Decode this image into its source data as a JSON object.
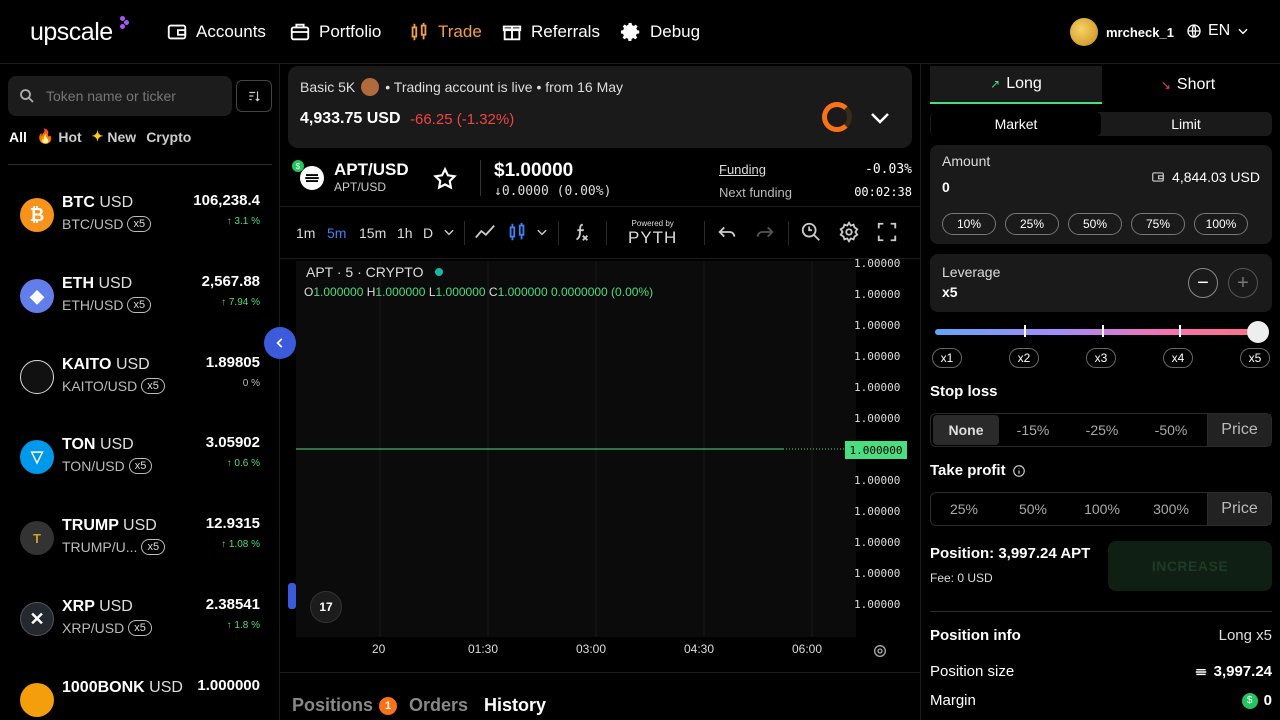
{
  "nav": {
    "logo": "upscale",
    "items": [
      {
        "label": "Accounts",
        "icon": "wallet-icon"
      },
      {
        "label": "Portfolio",
        "icon": "briefcase-icon"
      },
      {
        "label": "Trade",
        "icon": "candles-icon",
        "active": true
      },
      {
        "label": "Referrals",
        "icon": "gift-icon"
      },
      {
        "label": "Debug",
        "icon": "gear-icon"
      }
    ],
    "username": "mrcheck_1",
    "language": "EN"
  },
  "sidebar": {
    "search_placeholder": "Token name or ticker",
    "filters": [
      "All",
      "Hot",
      "New",
      "Crypto"
    ],
    "assets": [
      {
        "base": "BTC",
        "quote": "USD",
        "pair": "BTC/USD",
        "leverage": "x5",
        "price": "106,238.4",
        "change": "↑ 3.1 %",
        "color": "#f7931a",
        "glyph": "₿"
      },
      {
        "base": "ETH",
        "quote": "USD",
        "pair": "ETH/USD",
        "leverage": "x5",
        "price": "2,567.88",
        "change": "↑ 7.94 %",
        "color": "#627eea",
        "glyph": "◆"
      },
      {
        "base": "KAITO",
        "quote": "USD",
        "pair": "KAITO/USD",
        "leverage": "x5",
        "price": "1.89805",
        "change": "0 %",
        "color": "#ffffff",
        "glyph": ""
      },
      {
        "base": "TON",
        "quote": "USD",
        "pair": "TON/USD",
        "leverage": "x5",
        "price": "3.05902",
        "change": "↑ 0.6 %",
        "color": "#0098ea",
        "glyph": "▽"
      },
      {
        "base": "TRUMP",
        "quote": "USD",
        "pair": "TRUMP/U...",
        "leverage": "x5",
        "price": "12.9315",
        "change": "↑ 1.08 %",
        "color": "#c9a227",
        "glyph": "T"
      },
      {
        "base": "XRP",
        "quote": "USD",
        "pair": "XRP/USD",
        "leverage": "x5",
        "price": "2.38541",
        "change": "↑ 1.8 %",
        "color": "#23292f",
        "glyph": "✕"
      },
      {
        "base": "1000BONK",
        "quote": "USD",
        "pair": "",
        "leverage": "",
        "price": "1.000000",
        "change": "",
        "color": "#f59e0b",
        "glyph": ""
      }
    ]
  },
  "account": {
    "name": "Basic 5K",
    "status": "• Trading account is live • from 16 May",
    "balance": "4,933.75 USD",
    "change": "-66.25 (-1.32%)"
  },
  "ticker": {
    "symbol": "APT/USD",
    "pair": "APT/USD",
    "price": "$1.00000",
    "delta": "0.0000 (0.00%)",
    "funding_label": "Funding",
    "funding_rate": "-0.03%",
    "next_funding_label": "Next funding",
    "next_funding_time": "00:02:38"
  },
  "chart": {
    "timeframes": [
      "1m",
      "5m",
      "15m",
      "1h",
      "D"
    ],
    "selected_timeframe": "5m",
    "powered_by": "Powered by",
    "pyth": "PYTH",
    "legend_title": "APT · 5 · CRYPTO",
    "ohlc": {
      "o": "1.000000",
      "h": "1.000000",
      "l": "1.000000",
      "c": "1.000000",
      "chg": "0.0000000 (0.00%)"
    },
    "y_labels": [
      "1.00000",
      "1.00000",
      "1.00000",
      "1.00000",
      "1.00000",
      "1.00000",
      "1.00000",
      "1.00000",
      "1.00000",
      "1.00000",
      "1.00000",
      "1.00000"
    ],
    "last_price_tag": "1.000000",
    "x_labels": [
      "20",
      "01:30",
      "03:00",
      "04:30",
      "06:00"
    ],
    "tv_logo": "17"
  },
  "chart_data": {
    "type": "line",
    "x": [
      "20",
      "01:30",
      "03:00",
      "04:30",
      "06:00"
    ],
    "series": [
      {
        "values": [
          1.0,
          1.0,
          1.0,
          1.0,
          1.0
        ]
      }
    ]
  },
  "bottom_tabs": {
    "positions": "Positions",
    "positions_count": "1",
    "orders": "Orders",
    "history": "History"
  },
  "order": {
    "long": "Long",
    "short": "Short",
    "market": "Market",
    "limit": "Limit",
    "amount_label": "Amount",
    "amount_value": "0",
    "available": "4,844.03 USD",
    "percents": [
      "10%",
      "25%",
      "50%",
      "75%",
      "100%"
    ],
    "leverage_label": "Leverage",
    "leverage_value": "x5",
    "leverage_level": 5,
    "leverage_marks": [
      "x1",
      "x2",
      "x3",
      "x4",
      "x5"
    ],
    "stop_loss_label": "Stop loss",
    "stop_loss_options": [
      "None",
      "-15%",
      "-25%",
      "-50%",
      "Price"
    ],
    "take_profit_label": "Take profit",
    "take_profit_options": [
      "25%",
      "50%",
      "100%",
      "300%",
      "Price"
    ],
    "position_summary": "Position: 3,997.24 APT",
    "fee": "Fee: 0 USD",
    "increase": "INCREASE",
    "position_info_label": "Position info",
    "position_side": "Long x5",
    "position_size_label": "Position size",
    "position_size": "3,997.24",
    "margin_label": "Margin",
    "margin": "0"
  },
  "colors": {
    "accent": "#f59e4a",
    "up": "#4ade80",
    "down": "#ef4444",
    "blue": "#3b82f6"
  }
}
